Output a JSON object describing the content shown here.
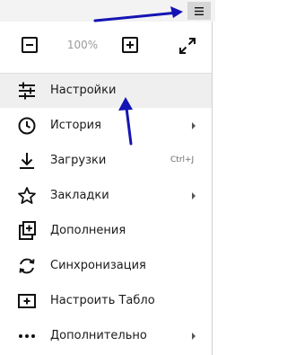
{
  "zoom": {
    "value": "100%"
  },
  "menu": {
    "items": [
      {
        "label": "Настройки"
      },
      {
        "label": "История"
      },
      {
        "label": "Загрузки",
        "shortcut": "Ctrl+J"
      },
      {
        "label": "Закладки"
      },
      {
        "label": "Дополнения"
      },
      {
        "label": "Синхронизация"
      },
      {
        "label": "Настроить Табло"
      },
      {
        "label": "Дополнительно"
      }
    ]
  },
  "annotation": {
    "arrow_color": "#1414b4"
  }
}
